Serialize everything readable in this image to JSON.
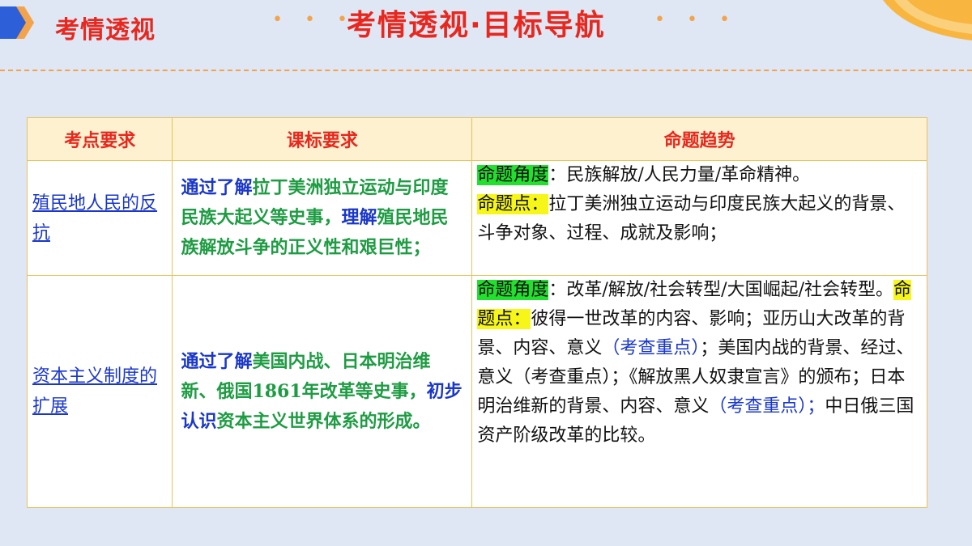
{
  "header": {
    "section_title": "考情透视",
    "main_title": "考情透视·目标导航",
    "dots_left": "• • •",
    "dots_right": "• • •"
  },
  "colors": {
    "accent_red": "#e8281e",
    "accent_orange": "#f2a34b",
    "link_blue": "#1a37c9",
    "text_green": "#1e9c43",
    "highlight_green": "#22e02e",
    "highlight_yellow": "#f6f618"
  },
  "table": {
    "headers": [
      "考点要求",
      "课标要求",
      "命题趋势"
    ],
    "rows": [
      {
        "topic": "殖民地人民的反抗",
        "req": {
          "p1": "通过了解",
          "p2": "拉丁美洲独立运动与印度民族大起义等史事，",
          "p3": "理解",
          "p4": "殖民地民族解放斗争的正义性和艰巨性；"
        },
        "trend": {
          "angle_label": "命题角度",
          "angle_text": "：民族解放/人民力量/革命精神。",
          "point_label": "命题点：",
          "point_text": "拉丁美洲独立运动与印度民族大起义的背景、斗争对象、过程、成就及影响；"
        }
      },
      {
        "topic": "资本主义制度的扩展",
        "req": {
          "p1": "通过了解",
          "p2": "美国内战、日本明治维新、俄国1861年改革等史事，",
          "p3": "初步认识",
          "p4": "资本主义世界体系的形成。"
        },
        "trend": {
          "angle_label": "命题角度",
          "angle_text": "：改革/解放/社会转型/大国崛起/社会转型。",
          "point_label": "命题点：",
          "t1": "彼得一世改革的内容、影响；亚历山大改革的背景、内容、意义",
          "t2": "（考查重点）",
          "t3": "；美国内战的背景、经过、意义（考查重点）；《解放黑人奴隶宣言》的颁布；日本明治维新的背景、内容、意义",
          "t4": "（考查重点）；",
          "t5": "中日俄三国资产阶级改革的比较。"
        }
      }
    ]
  }
}
